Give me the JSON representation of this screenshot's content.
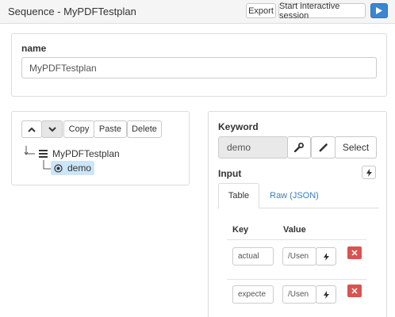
{
  "header": {
    "title": "Sequence - MyPDFTestplan",
    "export_label": "Export",
    "session_label": "Start interactive session",
    "run_icon": "play-icon"
  },
  "name_panel": {
    "label": "name",
    "value": "MyPDFTestplan"
  },
  "tree_toolbar": {
    "up_icon": "chevron-up-icon",
    "down_icon": "chevron-down-icon",
    "copy_label": "Copy",
    "paste_label": "Paste",
    "delete_label": "Delete"
  },
  "tree": {
    "root_label": "MyPDFTestplan",
    "child_label": "demo"
  },
  "keyword": {
    "label": "Keyword",
    "value": "demo",
    "select_label": "Select",
    "wrench_icon": "wrench-icon",
    "pencil_icon": "pencil-icon"
  },
  "input": {
    "label": "Input",
    "bolt_icon": "bolt-icon",
    "tabs": [
      "Table",
      "Raw (JSON)"
    ],
    "columns": [
      "Key",
      "Value"
    ],
    "rows": [
      {
        "key": "actual",
        "value": "/Usen"
      },
      {
        "key": "expecte",
        "value": "/Usen"
      }
    ]
  },
  "colors": {
    "accent": "#3a87cf",
    "danger": "#d9534f",
    "selection": "#cde6f7"
  }
}
